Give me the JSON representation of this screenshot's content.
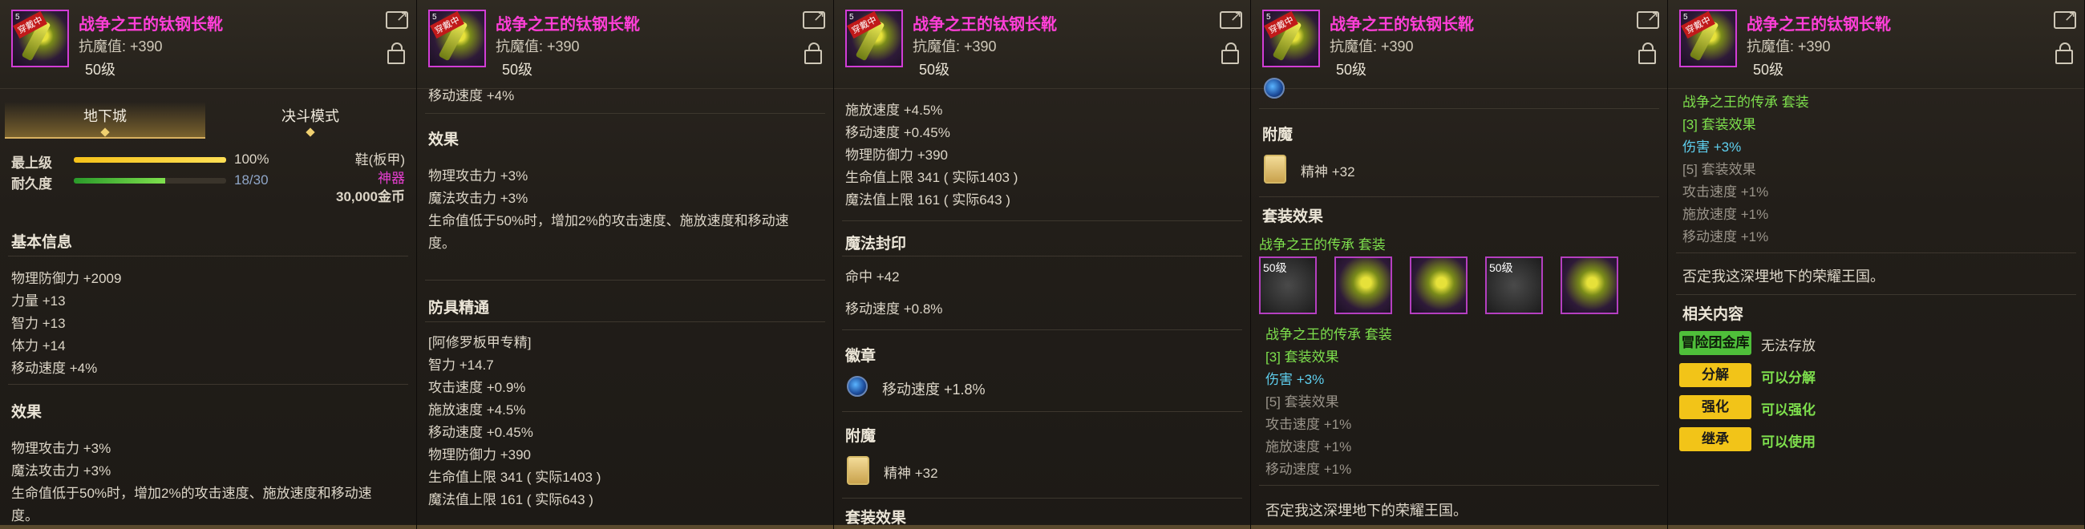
{
  "item": {
    "name": "战争之王的钛钢长靴",
    "magic_resist": "抗魔值: +390",
    "level": "50级",
    "icon_tier": "5",
    "icon_tag": "穿戴中"
  },
  "p1": {
    "tab_dungeon": "地下城",
    "tab_duel": "决斗模式",
    "max_label": "最上级",
    "max_value": "100%",
    "max_fill": 1.0,
    "dur_label": "耐久度",
    "dur_value": "18/30",
    "dur_fill": 0.6,
    "slot_type": "鞋(板甲)",
    "rarity": "神器",
    "price": "30,000金币",
    "basic_title": "基本信息",
    "basic": [
      "物理防御力 +2009",
      "力量 +13",
      "智力 +13",
      "体力 +14",
      "移动速度 +4%"
    ],
    "effect_title": "效果",
    "effects": [
      "物理攻击力 +3%",
      "魔法攻击力 +3%",
      "生命值低于50%时，增加2%的攻击速度、施放速度和移动速",
      "度。"
    ]
  },
  "p2": {
    "top_cut": "移动速度 +4%",
    "effect_title": "效果",
    "effects": [
      "物理攻击力 +3%",
      "魔法攻击力 +3%",
      "生命值低于50%时，增加2%的攻击速度、施放速度和移动速",
      "度。"
    ],
    "mastery_title": "防具精通",
    "mastery": [
      "[阿修罗板甲专精]",
      "智力 +14.7",
      "攻击速度 +0.9%",
      "施放速度 +4.5%",
      "移动速度 +0.45%",
      "物理防御力 +390",
      "生命值上限 341 ( 实际1403 )",
      "魔法值上限 161 ( 实际643 )"
    ]
  },
  "p3": {
    "lines": [
      "施放速度 +4.5%",
      "移动速度 +0.45%",
      "物理防御力 +390",
      "生命值上限 341 ( 实际1403 )",
      "魔法值上限 161 ( 实际643 )"
    ],
    "seal_title": "魔法封印",
    "seal": [
      "命中 +42",
      "移动速度 +0.8%"
    ],
    "emblem_title": "徽章",
    "emblem": "移动速度 +1.8%",
    "enchant_title": "附魔",
    "enchant": "精神 +32",
    "set_cut": "套装效果"
  },
  "p4": {
    "enchant_title": "附魔",
    "enchant": "精神 +32",
    "set_title": "套装效果",
    "set_name": "战争之王的传承  套装",
    "slot_label": "50级",
    "set_name2": "战争之王的传承  套装",
    "set3": "[3] 套装效果",
    "set3_val": "伤害 +3%",
    "set5": "[5] 套装效果",
    "set5_vals": [
      "攻击速度 +1%",
      "施放速度 +1%",
      "移动速度 +1%"
    ],
    "flavor": "否定我这深埋地下的荣耀王国。"
  },
  "p5": {
    "set_name": "战争之王的传承  套装",
    "set3": "[3] 套装效果",
    "set3_val": "伤害 +3%",
    "set5": "[5] 套装效果",
    "set5_vals": [
      "攻击速度 +1%",
      "施放速度 +1%",
      "移动速度 +1%"
    ],
    "flavor": "否定我这深埋地下的荣耀王国。",
    "related_title": "相关内容",
    "rows": [
      {
        "btn": "冒险团金库",
        "val": "无法存放"
      },
      {
        "btn": "分解",
        "val": "可以分解"
      },
      {
        "btn": "强化",
        "val": "可以强化"
      },
      {
        "btn": "继承",
        "val": "可以使用"
      }
    ]
  },
  "colors": {
    "title": "#ff3fd8",
    "set_green": "#7ee04d",
    "bonus_cyan": "#5fd0f0",
    "rarity_pink": "#e83fd2",
    "button_yellow": "#f2c418",
    "button_green": "#4fbf3a"
  }
}
